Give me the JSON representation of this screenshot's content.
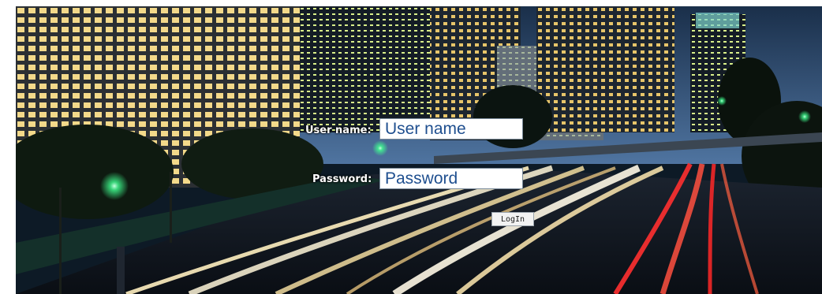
{
  "login": {
    "username_label": "User name:",
    "username_placeholder": "User name",
    "password_label": "Password:",
    "password_placeholder": "Password",
    "submit_label": "LogIn"
  },
  "colors": {
    "input_text": "#1f4f8f",
    "label_text": "#ffffff",
    "sky": "#2e4f78",
    "light_trail_warm": "#fff0c0",
    "light_trail_red": "#ff3030",
    "traffic_green": "#40ff90"
  }
}
